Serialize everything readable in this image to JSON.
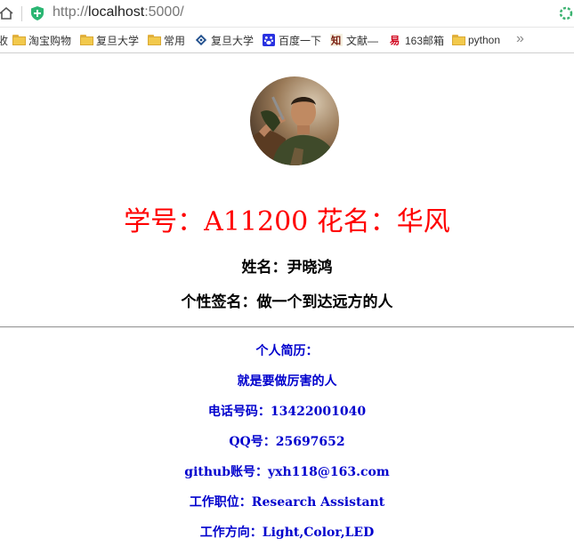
{
  "browser": {
    "url_prefix": "http://",
    "url_host": "localhost",
    "url_suffix": ":5000/"
  },
  "bookmarks": {
    "partial_first": "收",
    "items": [
      {
        "label": "淘宝购物",
        "icon": "folder-icon"
      },
      {
        "label": "复旦大学",
        "icon": "folder-icon"
      },
      {
        "label": "常用",
        "icon": "folder-icon"
      },
      {
        "label": "复旦大学",
        "icon": "fudan-logo-icon"
      },
      {
        "label": "百度一下",
        "icon": "baidu-icon"
      },
      {
        "label": "文献—",
        "icon": "zhi-icon"
      },
      {
        "label": "163邮箱",
        "icon": "mail163-icon"
      },
      {
        "label": "python",
        "icon": "folder-icon"
      }
    ],
    "more": "»"
  },
  "profile": {
    "title": "学号：A11200 花名：华风",
    "name": "姓名：尹晓鸿",
    "signature": "个性签名：做一个到达远方的人",
    "resume_heading": "个人简历：",
    "resume_text": "就是要做厉害的人",
    "phone": "电话号码：13422001040",
    "qq": "QQ号：25697652",
    "github": "github账号：yxh118@163.com",
    "position": "工作职位：Research Assistant",
    "direction": "工作方向：Light,Color,LED"
  },
  "colors": {
    "title": "#ff0000",
    "info": "#0000cd"
  }
}
